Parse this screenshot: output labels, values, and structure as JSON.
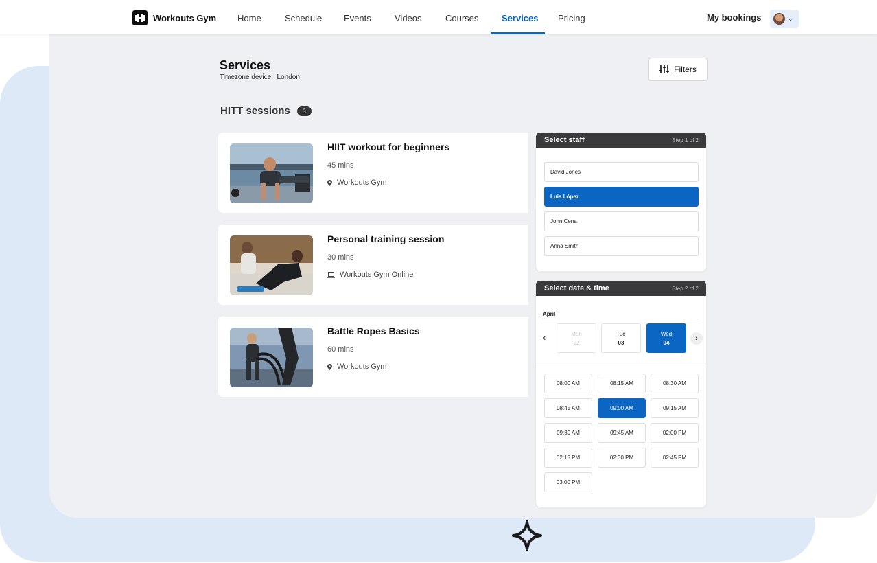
{
  "nav": {
    "brand": "Workouts Gym",
    "items": [
      {
        "label": "Home"
      },
      {
        "label": "Schedule"
      },
      {
        "label": "Events"
      },
      {
        "label": "Videos"
      },
      {
        "label": "Courses"
      },
      {
        "label": "Services",
        "active": true
      },
      {
        "label": "Pricing"
      }
    ],
    "bookings_label": "My bookings"
  },
  "header": {
    "title": "Services",
    "timezone": "Timezone device : London",
    "filters_label": "Filters"
  },
  "section": {
    "title": "HITT sessions",
    "count": "3"
  },
  "services": [
    {
      "title": "HIIT workout for beginners",
      "duration": "45 mins",
      "location": "Workouts Gym",
      "location_icon": "map-pin-icon"
    },
    {
      "title": "Personal training session",
      "duration": "30 mins",
      "location": "Workouts Gym Online",
      "location_icon": "laptop-icon"
    },
    {
      "title": "Battle Ropes Basics",
      "duration": "60 mins",
      "location": "Workouts Gym",
      "location_icon": "map-pin-icon"
    }
  ],
  "staff_panel": {
    "title": "Select staff",
    "step": "Step 1 of 2",
    "staff": [
      "David Jones",
      "Luis López",
      "John Cena",
      "Anna Smith"
    ],
    "selected": "Luis López"
  },
  "date_panel": {
    "title": "Select date & time",
    "step": "Step 2 of 2",
    "month": "April",
    "days": [
      {
        "name": "Mon",
        "num": "02",
        "state": "disabled"
      },
      {
        "name": "Tue",
        "num": "03",
        "state": "normal"
      },
      {
        "name": "Wed",
        "num": "04",
        "state": "selected"
      }
    ],
    "slots": [
      "08:00 AM",
      "08:15 AM",
      "08:30 AM",
      "08:45 AM",
      "09:00 AM",
      "09:15 AM",
      "09:30 AM",
      "09:45 AM",
      "02:00 PM",
      "02:15 PM",
      "02:30 PM",
      "02:45 PM",
      "03:00 PM"
    ],
    "selected_slot": "09:00 AM"
  },
  "colors": {
    "accent": "#0a66c2",
    "panel_header": "#3a3a3c",
    "app_background": "#eff0f3",
    "outer_background": "#dde9f7"
  }
}
